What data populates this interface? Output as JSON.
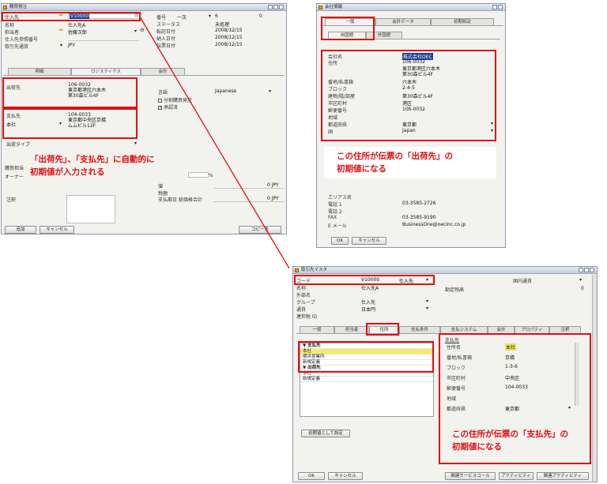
{
  "win1": {
    "title": "購買発注",
    "left_fields": [
      {
        "label": "仕入先",
        "value": "V10000"
      },
      {
        "label": "名称",
        "value": "仕入先A"
      },
      {
        "label": "担当者",
        "value": "佐藤次郎"
      },
      {
        "label": "仕入先参照番号",
        "value": ""
      },
      {
        "label": "取引先通貨",
        "value": "JPY"
      }
    ],
    "right_fields": [
      {
        "label": "番号",
        "value": "一次",
        "extra": "6",
        "extra2": "0"
      },
      {
        "label": "ステータス",
        "value": "未処理"
      },
      {
        "label": "転記日付",
        "value": "2008/12/15"
      },
      {
        "label": "納入日付",
        "value": "2008/12/15"
      },
      {
        "label": "伝票日付",
        "value": "2008/12/15"
      }
    ],
    "tabs": [
      "明細",
      "ロジスティクス",
      "会計"
    ],
    "ship_to_label": "出荷先",
    "ship_to_value": [
      "106-0032",
      "東京都港区六本木",
      "第30森ビル4F"
    ],
    "pay_to_label": "支払先",
    "pay_to_combo": "本社",
    "pay_to_value": [
      "104-0033",
      "東京都中央区京橋",
      "ムムビル12F"
    ],
    "ship_type_label": "出荷タイプ",
    "language_label": "言語",
    "language_value": "Japanese",
    "check1": "分割購買発注",
    "check2": "承認済",
    "total_before_disc_label": "購買担当",
    "owner_label": "オーナー",
    "remarks_label": "注釈",
    "discount_pct": "%",
    "rows_right": [
      {
        "label": "値",
        "value": "0 JPY"
      },
      {
        "label": "税額",
        "value": ""
      },
      {
        "label": "支払期日 総価格合計",
        "value": "0 JPY"
      }
    ],
    "btn_add": "追加",
    "btn_cancel": "キャンセル",
    "btn_copy": "コピー先"
  },
  "win2": {
    "title": "会社情報",
    "tabs": [
      "一般",
      "会計データ",
      "初期設定"
    ],
    "subtabs": [
      "自国語",
      "外国語"
    ],
    "fields": [
      {
        "label": "会社名",
        "value": "株式会社OEC"
      },
      {
        "label": "住所",
        "value": "106-0032"
      },
      {
        "label": "",
        "value": "東京都港区六本木"
      },
      {
        "label": "",
        "value": "第30森ビル4F"
      },
      {
        "label": "番地/私書箱",
        "value": "六本木"
      },
      {
        "label": "ブロック",
        "value": "2-4-5"
      },
      {
        "label": "建物/階/部屋",
        "value": "第30森ビル4F"
      },
      {
        "label": "市区町村",
        "value": "港区"
      },
      {
        "label": "郵便番号",
        "value": "106-0032"
      },
      {
        "label": "地域",
        "value": ""
      },
      {
        "label": "都道府県",
        "value": "東京都"
      },
      {
        "label": "国",
        "value": "Japan"
      }
    ],
    "lower_fields": [
      {
        "label": "エリアス名",
        "value": ""
      },
      {
        "label": "電話 1",
        "value": "03-3585-2726"
      },
      {
        "label": "電話 2",
        "value": ""
      },
      {
        "label": "FAX",
        "value": "03-3585-9190"
      },
      {
        "label": "E メール",
        "value": "BusinessOne@oecinc.co.jp"
      }
    ],
    "btn_ok": "OK",
    "btn_cancel": "キャンセル"
  },
  "win3": {
    "title": "取引先マスタ",
    "fields": [
      {
        "label": "コード",
        "value": "V10000",
        "extra": "仕入先"
      },
      {
        "label": "名称",
        "value": "仕入先A"
      },
      {
        "label": "外部名",
        "value": ""
      },
      {
        "label": "グループ",
        "value": "仕入先"
      },
      {
        "label": "通貨",
        "value": "日本円"
      },
      {
        "label": "連邦税 ID",
        "value": ""
      }
    ],
    "currency_label": "国内通貨",
    "balance_label": "勘定残高",
    "balance_value": "0",
    "tabs": [
      "一般",
      "担当者",
      "住所",
      "支払条件",
      "支払システム",
      "会計",
      "プロパティ",
      "注釈"
    ],
    "tree": [
      {
        "text": "▼ 支払先",
        "bold": true
      },
      {
        "text": "本社",
        "y": true
      },
      {
        "text": "横浜営業所",
        "y": false
      },
      {
        "text": "新規定義",
        "y": false
      },
      {
        "text": "▼ 出荷先",
        "bold": true
      },
      {
        "text": "本社",
        "y": false
      },
      {
        "text": "新規定義",
        "y": false
      }
    ],
    "addr_header": "支払先",
    "addr_fields": [
      {
        "label": "住所名",
        "value": "本社"
      },
      {
        "label": "番地/私書箱",
        "value": "京橋"
      },
      {
        "label": "ブロック",
        "value": "1-3-6"
      },
      {
        "label": "市区町村",
        "value": "中央区"
      },
      {
        "label": "郵便番号",
        "value": "104-0033"
      },
      {
        "label": "地域",
        "value": ""
      },
      {
        "label": "都道府県",
        "value": "東京都"
      }
    ],
    "btn_default": "初期値として設定",
    "btn_ok": "OK",
    "btn_cancel": "キャンセル",
    "btn_service": "関連サービスコール",
    "btn_activity": "アクティビティ",
    "btn_related_activity": "関連アクティビティ"
  },
  "callouts": {
    "c1_line1": "「出荷先」、「支払先」に自動的に",
    "c1_line2": "初期値が入力される",
    "c2_line1": "この住所が伝票の「出荷先」の",
    "c2_line2": "初期値になる",
    "c3_line1": "この住所が伝票の「支払先」の",
    "c3_line2": "初期値になる"
  },
  "colors": {
    "accent_red": "#e01010",
    "highlight_yellow": "#f5e35a",
    "selection_blue": "#1d3f9a"
  }
}
